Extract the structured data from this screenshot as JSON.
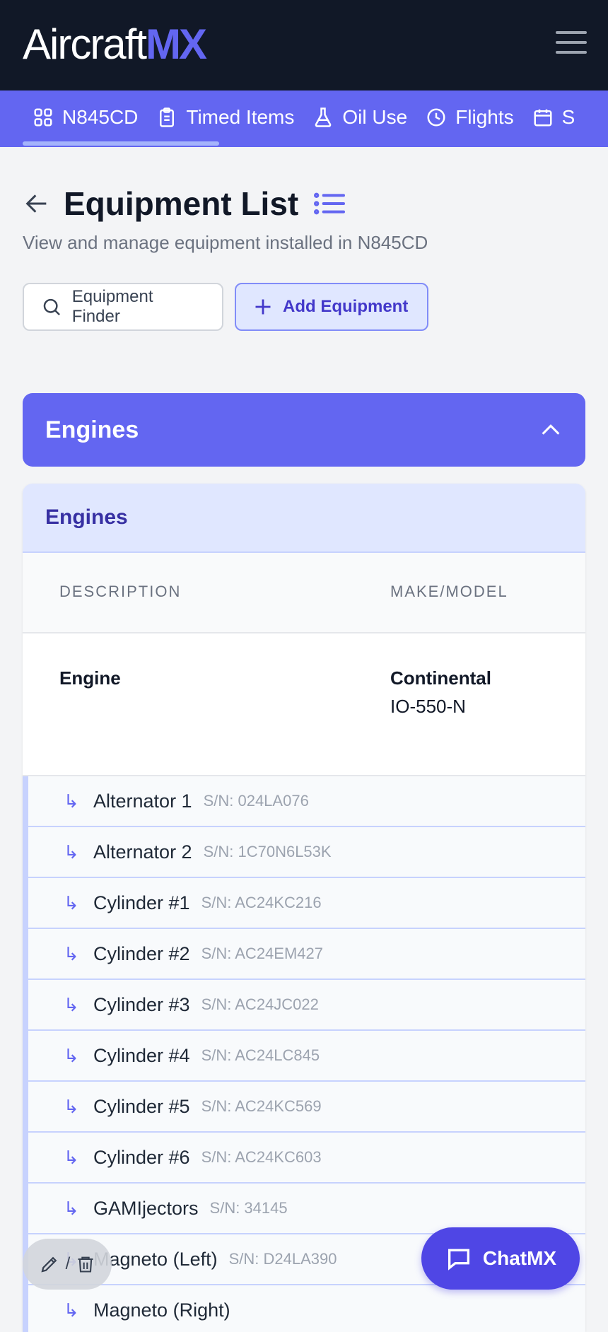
{
  "app": {
    "brand_prefix": "Aircraft",
    "brand_suffix": "MX"
  },
  "nav": {
    "tabs": [
      {
        "label": "N845CD",
        "icon": "grid-icon"
      },
      {
        "label": "Timed Items",
        "icon": "clipboard-icon"
      },
      {
        "label": "Oil Use",
        "icon": "flask-icon"
      },
      {
        "label": "Flights",
        "icon": "clock-icon"
      },
      {
        "label": "S",
        "icon": "calendar-icon"
      }
    ]
  },
  "page": {
    "title": "Equipment List",
    "subtitle": "View and manage equipment installed in N845CD"
  },
  "actions": {
    "finder_label": "Equipment Finder",
    "add_label": "Add Equipment"
  },
  "accordion": {
    "label": "Engines"
  },
  "panel": {
    "title": "Engines",
    "columns": {
      "description": "DESCRIPTION",
      "make_model": "MAKE/MODEL"
    },
    "engine": {
      "description": "Engine",
      "make": "Continental",
      "model": "IO-550-N"
    },
    "arrow_glyph": "↳",
    "sub_items": [
      {
        "name": "Alternator 1",
        "sn": "S/N: 024LA076"
      },
      {
        "name": "Alternator 2",
        "sn": "S/N: 1C70N6L53K"
      },
      {
        "name": "Cylinder #1",
        "sn": "S/N: AC24KC216"
      },
      {
        "name": "Cylinder #2",
        "sn": "S/N: AC24EM427"
      },
      {
        "name": "Cylinder #3",
        "sn": "S/N: AC24JC022"
      },
      {
        "name": "Cylinder #4",
        "sn": "S/N: AC24LC845"
      },
      {
        "name": "Cylinder #5",
        "sn": "S/N: AC24KC569"
      },
      {
        "name": "Cylinder #6",
        "sn": "S/N: AC24KC603"
      },
      {
        "name": "GAMIjectors",
        "sn": "S/N: 34145"
      },
      {
        "name": "Magneto (Left)",
        "sn": "S/N: D24LA390"
      },
      {
        "name": "Magneto (Right)",
        "sn": ""
      }
    ]
  },
  "floating": {
    "edit_separator": "/",
    "chat_label": "ChatMX"
  },
  "colors": {
    "header_bg": "#111827",
    "accent": "#6366f1",
    "accent_dark": "#4f46e5",
    "accent_light": "#e0e7ff"
  }
}
